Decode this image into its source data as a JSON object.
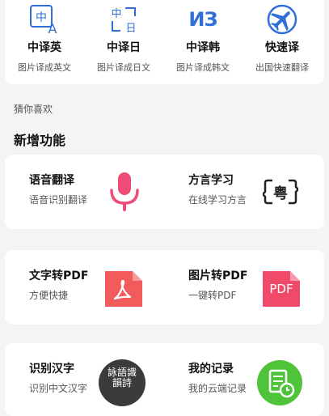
{
  "quick_tools": [
    {
      "title": "中译英",
      "subtitle": "图片译成英文",
      "icon": "translate-zh-en-icon"
    },
    {
      "title": "中译日",
      "subtitle": "图片译成日文",
      "icon": "translate-zh-ja-icon"
    },
    {
      "title": "中译韩",
      "subtitle": "图片译成韩文",
      "icon": "translate-zh-ko-icon",
      "glyph": "ИЗ"
    },
    {
      "title": "快速译",
      "subtitle": "出国快速翻译",
      "icon": "airplane-icon"
    }
  ],
  "section_hint": "猜你喜欢",
  "section_title": "新增功能",
  "features": [
    {
      "title": "语音翻译",
      "subtitle": "语音识别翻译",
      "icon": "microphone-icon"
    },
    {
      "title": "方言学习",
      "subtitle": "在线学习方言",
      "icon": "cantonese-speech-icon",
      "glyph": "粤"
    },
    {
      "title": "文字转PDF",
      "subtitle": "方便快捷",
      "icon": "pdf-file-icon"
    },
    {
      "title": "图片转PDF",
      "subtitle": "一键转PDF",
      "icon": "pdf-document-icon",
      "glyph": "PDF"
    },
    {
      "title": "识别汉字",
      "subtitle": "识别中文汉字",
      "icon": "chinese-characters-icon",
      "glyph": "詠語識韻詩"
    },
    {
      "title": "我的记录",
      "subtitle": "我的云端记录",
      "icon": "records-clock-icon"
    }
  ],
  "colors": {
    "blue": "#2f6fd6",
    "pink": "#ef4d78",
    "red": "#f15b5b",
    "green": "#4fc43a",
    "dark": "#3b3b3b"
  }
}
